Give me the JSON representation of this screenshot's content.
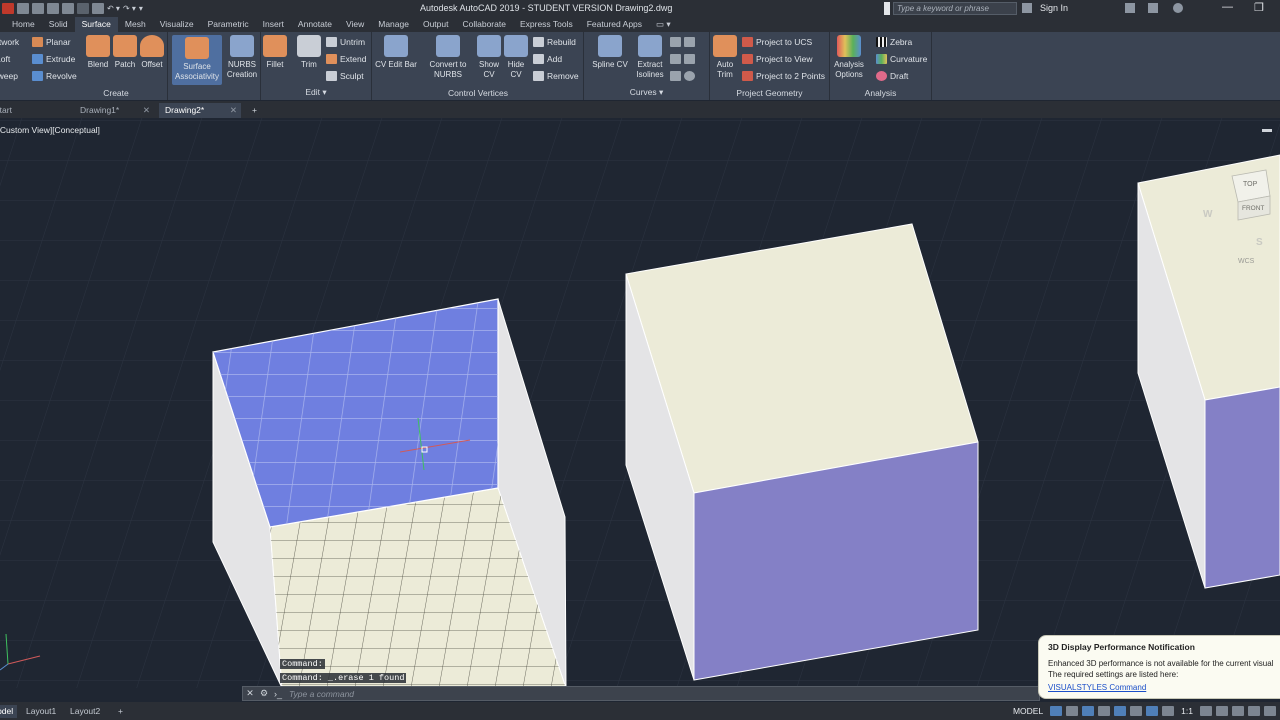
{
  "window": {
    "title": "Autodesk AutoCAD 2019 - STUDENT VERSION    Drawing2.dwg",
    "search_placeholder": "Type a keyword or phrase",
    "sign_in": "Sign In"
  },
  "ribbon_tabs": [
    "Home",
    "Solid",
    "Surface",
    "Mesh",
    "Visualize",
    "Parametric",
    "Insert",
    "Annotate",
    "View",
    "Manage",
    "Output",
    "Collaborate",
    "Express Tools",
    "Featured Apps"
  ],
  "active_tab": "Surface",
  "panels": {
    "create": {
      "label": "Create",
      "small_left": [
        "Network",
        "Loft",
        "Sweep"
      ],
      "small_right": [
        "Planar",
        "Extrude",
        "Revolve"
      ],
      "big": [
        "Blend",
        "Patch",
        "Offset"
      ]
    },
    "assoc": {
      "line1": "Surface",
      "line2": "Associativity"
    },
    "nurbs": {
      "line1": "NURBS",
      "line2": "Creation"
    },
    "edit": {
      "label": "Edit",
      "big": [
        "Fillet",
        "Trim"
      ],
      "small": [
        "Untrim",
        "Extend",
        "Sculpt"
      ]
    },
    "cvedit": {
      "label": "CV Edit Bar"
    },
    "control_vertices": {
      "label": "Control Vertices",
      "convert": {
        "line1": "Convert to",
        "line2": "NURBS"
      },
      "show": {
        "line1": "Show",
        "line2": "CV"
      },
      "hide": {
        "line1": "Hide",
        "line2": "CV"
      },
      "small": [
        "Rebuild",
        "Add",
        "Remove"
      ]
    },
    "curves": {
      "label": "Curves",
      "spline": "Spline CV",
      "extract": {
        "line1": "Extract",
        "line2": "Isolines"
      }
    },
    "project": {
      "label": "Project Geometry",
      "auto": {
        "line1": "Auto",
        "line2": "Trim"
      },
      "small": [
        "Project to UCS",
        "Project to View",
        "Project to 2 Points"
      ]
    },
    "analysis": {
      "label": "Analysis",
      "options": {
        "line1": "Analysis",
        "line2": "Options"
      },
      "small": [
        "Zebra",
        "Curvature",
        "Draft"
      ]
    }
  },
  "doc_tabs": [
    "Start",
    "Drawing1*",
    "Drawing2*"
  ],
  "viewport_label": "[-][Custom View][Conceptual]",
  "viewcube": {
    "top": "TOP",
    "front": "FRONT",
    "west": "W",
    "south": "S",
    "wcs": "WCS"
  },
  "command": {
    "history": [
      "Command:",
      "Command: _.erase 1 found"
    ],
    "placeholder": "Type a command"
  },
  "layout_tabs": [
    "Model",
    "Layout1",
    "Layout2"
  ],
  "status": {
    "model": "MODEL",
    "scale": "1:1"
  },
  "notification": {
    "title": "3D Display Performance Notification",
    "line1": "Enhanced 3D performance is not available for the current visual",
    "line2": "The required settings are listed here:",
    "link": "VISUALSTYLES Command"
  },
  "colors": {
    "viewport_bg": "#1f2632",
    "surface_face": "#ecebd8",
    "side_face": "#e4e4e6",
    "blue_face": "#8480c6",
    "selected_face": "#6f7fe0"
  }
}
